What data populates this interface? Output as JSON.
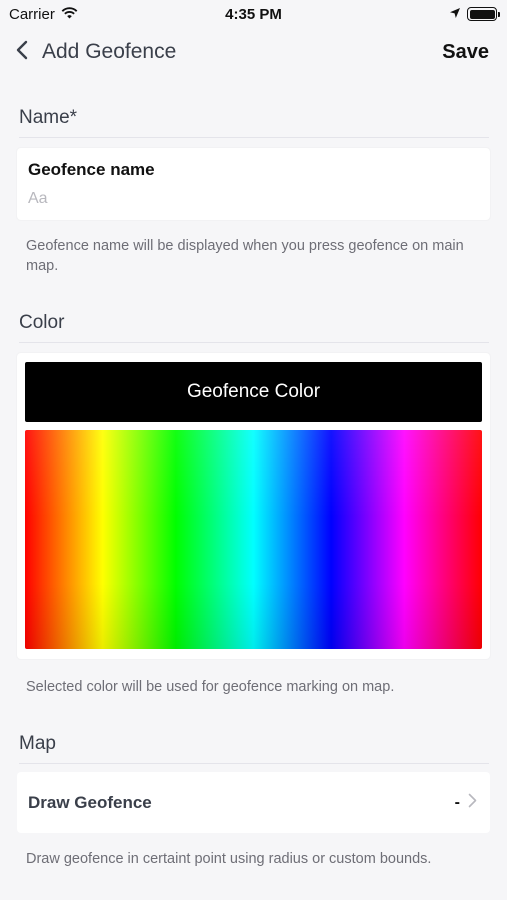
{
  "status": {
    "carrier": "Carrier",
    "time": "4:35 PM"
  },
  "nav": {
    "title": "Add Geofence",
    "save_label": "Save"
  },
  "name_section": {
    "header": "Name*",
    "field_label": "Geofence name",
    "placeholder": "Aa",
    "value": "",
    "helper": "Geofence name will be displayed when you press geofence on main map."
  },
  "color_section": {
    "header": "Color",
    "preview_label": "Geofence Color",
    "selected_color": "#000000",
    "helper": "Selected color will be used for geofence marking on map."
  },
  "map_section": {
    "header": "Map",
    "row_label": "Draw Geofence",
    "row_value": "-",
    "helper": "Draw geofence in certaint point using radius or custom bounds."
  },
  "icons": [
    "wifi-icon",
    "location-arrow-icon",
    "battery-icon",
    "back-chevron-icon",
    "chevron-right-icon"
  ]
}
